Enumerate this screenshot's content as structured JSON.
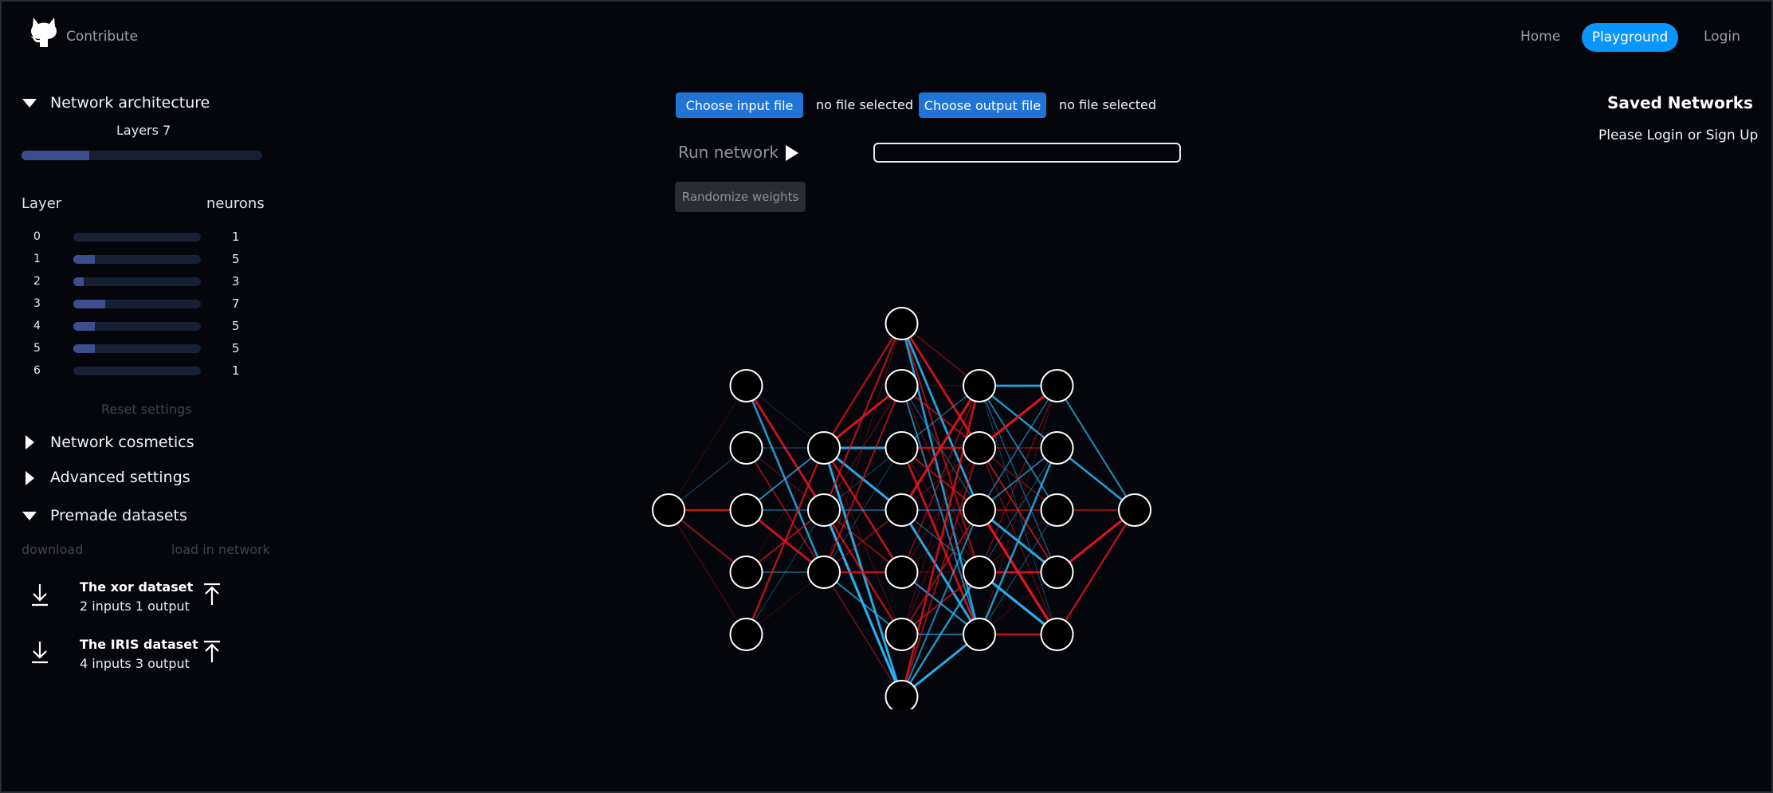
{
  "header": {
    "contribute": "Contribute",
    "nav": {
      "home": "Home",
      "playground": "Playground",
      "login": "Login"
    }
  },
  "sidebar": {
    "architecture": {
      "title": "Network architecture",
      "layers_label": "Layers 7",
      "layers_fraction": 0.28,
      "col_layer": "Layer",
      "col_neurons": "neurons",
      "layers": [
        {
          "index": "0",
          "neurons": "1",
          "fraction": 0.0
        },
        {
          "index": "1",
          "neurons": "5",
          "fraction": 0.17
        },
        {
          "index": "2",
          "neurons": "3",
          "fraction": 0.08
        },
        {
          "index": "3",
          "neurons": "7",
          "fraction": 0.25
        },
        {
          "index": "4",
          "neurons": "5",
          "fraction": 0.17
        },
        {
          "index": "5",
          "neurons": "5",
          "fraction": 0.17
        },
        {
          "index": "6",
          "neurons": "1",
          "fraction": 0.0
        }
      ],
      "reset": "Reset settings"
    },
    "cosmetics": "Network cosmetics",
    "advanced": "Advanced settings",
    "datasets": {
      "title": "Premade datasets",
      "col_download": "download",
      "col_load": "load in network",
      "items": [
        {
          "name": "The xor dataset",
          "desc": "2 inputs 1 output"
        },
        {
          "name": "The IRIS dataset",
          "desc": "4 inputs 3 output"
        }
      ]
    }
  },
  "controls": {
    "input_button": "Choose input file",
    "input_status": "no file selected",
    "output_button": "Choose output file",
    "output_status": "no file selected",
    "run": "Run network",
    "randomize": "Randomize weights"
  },
  "saved": {
    "title": "Saved Networks",
    "message": "Please Login or Sign Up"
  },
  "network": {
    "layer_sizes": [
      1,
      5,
      3,
      7,
      5,
      5,
      1
    ],
    "colors": {
      "positive": "#2ab4f0",
      "negative": "#e8141e",
      "node_fill": "#000000",
      "node_stroke": "#ffffff"
    }
  }
}
